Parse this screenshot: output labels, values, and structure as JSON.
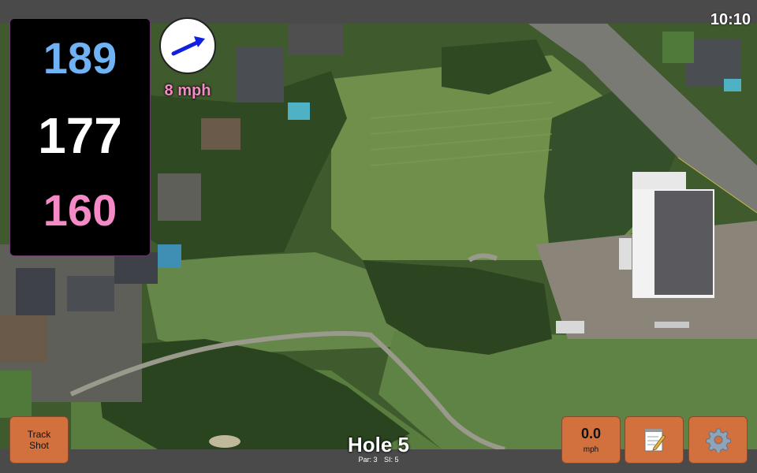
{
  "status": {
    "time": "10:10"
  },
  "distances": {
    "back": "189",
    "middle": "177",
    "front": "160"
  },
  "wind": {
    "speed": "8 mph",
    "arrow_icon": "wind-direction-arrow-icon"
  },
  "hole": {
    "title": "Hole 5",
    "par": "Par: 3",
    "stroke_index": "SI: 5"
  },
  "buttons": {
    "track_shot": {
      "line1": "Track",
      "line2": "Shot"
    },
    "speed": {
      "value": "0.0",
      "unit": "mph"
    },
    "notes_icon": "notepad-icon",
    "settings_icon": "gear-icon"
  },
  "colors": {
    "button": "#d2703e",
    "back_distance": "#6fb3f5",
    "middle_distance": "#ffffff",
    "front_distance": "#f48ac6",
    "wind_text": "#f48ac6"
  }
}
